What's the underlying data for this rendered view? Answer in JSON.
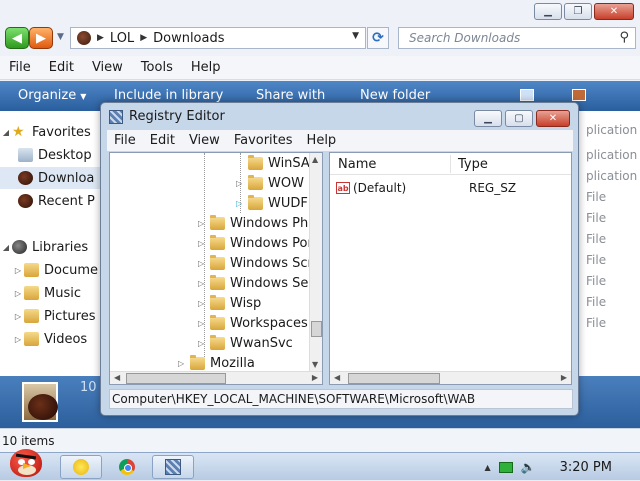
{
  "explorer": {
    "address": {
      "crumbs": [
        "LOL",
        "Downloads"
      ]
    },
    "search_placeholder": "Search Downloads",
    "menu": [
      "File",
      "Edit",
      "View",
      "Tools",
      "Help"
    ],
    "commands": {
      "organize": "Organize",
      "include": "Include in library",
      "share": "Share with",
      "new_folder": "New folder"
    },
    "nav": {
      "favorites": "Favorites",
      "desktop": "Desktop",
      "downloads": "Downloa",
      "recent": "Recent P",
      "libraries": "Libraries",
      "documents": "Docume",
      "music": "Music",
      "pictures": "Pictures",
      "videos": "Videos"
    },
    "right_list": [
      "plication",
      "plication",
      "plication",
      "File",
      "File",
      "File",
      "File",
      "File",
      "File",
      "File"
    ],
    "details_count": "10",
    "status": "10 items"
  },
  "regedit": {
    "title": "Registry Editor",
    "menu": [
      "File",
      "Edit",
      "View",
      "Favorites",
      "Help"
    ],
    "tree": [
      "WinSA",
      "WOW",
      "WUDF",
      "Windows Pho",
      "Windows Por",
      "Windows Scr",
      "Windows Sea",
      "Wisp",
      "Workspaces",
      "WwanSvc",
      "Mozilla"
    ],
    "columns": {
      "name": "Name",
      "type": "Type"
    },
    "values": [
      {
        "name": "(Default)",
        "type": "REG_SZ"
      }
    ],
    "status": "Computer\\HKEY_LOCAL_MACHINE\\SOFTWARE\\Microsoft\\WAB"
  },
  "taskbar": {
    "time": "3:20 PM"
  },
  "icons": {
    "back": "arrow-left-icon",
    "forward": "arrow-right-icon",
    "refresh": "refresh-icon",
    "search": "magnifier-icon",
    "minimize": "minimize-icon",
    "maximize": "maximize-icon",
    "close": "close-icon"
  }
}
